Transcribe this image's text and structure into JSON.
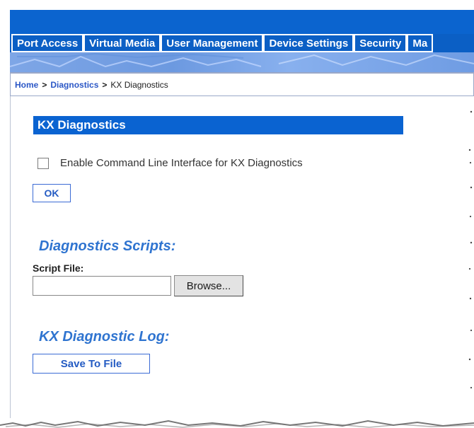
{
  "nav": {
    "tabs": [
      "Port Access",
      "Virtual Media",
      "User Management",
      "Device Settings",
      "Security",
      "Ma"
    ]
  },
  "breadcrumb": {
    "home": "Home",
    "separator1": ">",
    "diagnostics": "Diagnostics",
    "separator2": ">",
    "current": "KX Diagnostics"
  },
  "section": {
    "title": "KX Diagnostics",
    "checkbox_label": "Enable Command Line Interface for KX Diagnostics",
    "checkbox_checked": false,
    "ok_label": "OK"
  },
  "scripts": {
    "heading": "Diagnostics Scripts:",
    "file_label": "Script File:",
    "file_value": "",
    "browse_label": "Browse..."
  },
  "log": {
    "heading": "KX Diagnostic Log:",
    "save_label": "Save To File"
  },
  "colors": {
    "header_blue": "#0b5fc5",
    "section_blue": "#0a63d1",
    "link_blue": "#2b57c6",
    "heading_blue": "#2f74d0"
  },
  "icons": [
    "checkbox-icon"
  ]
}
